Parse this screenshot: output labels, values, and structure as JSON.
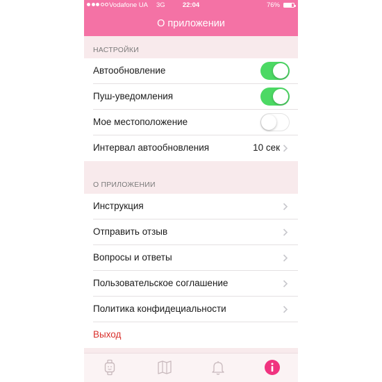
{
  "status_bar": {
    "signal": [
      true,
      true,
      true,
      false,
      false
    ],
    "carrier": "Vodafone UA",
    "network": "3G",
    "time": "22:04",
    "battery_percent": "76%",
    "battery_level": 0.76
  },
  "nav": {
    "title": "О приложении"
  },
  "settings_section": {
    "header": "НАСТРОЙКИ",
    "auto_update": {
      "label": "Автообновление",
      "enabled": true
    },
    "push_notifications": {
      "label": "Пуш-уведомления",
      "enabled": true
    },
    "location": {
      "label": "Мое местоположение",
      "enabled": false
    },
    "update_interval": {
      "label": "Интервал автообновления",
      "value": "10 сек"
    }
  },
  "about_section": {
    "header": "О ПРИЛОЖЕНИИ",
    "items": {
      "instructions": "Инструкция",
      "feedback": "Отправить отзыв",
      "faq": "Вопросы и ответы",
      "user_agreement": "Пользовательское соглашение",
      "privacy_policy": "Политика конфидециальности"
    },
    "logout": "Выход"
  },
  "tab_bar": {
    "tabs": [
      {
        "icon": "watch-icon",
        "active": false
      },
      {
        "icon": "map-icon",
        "active": false
      },
      {
        "icon": "bell-icon",
        "active": false
      },
      {
        "icon": "info-icon",
        "active": true
      }
    ]
  },
  "colors": {
    "accent": "#f472a5",
    "toggle_on": "#4cd964",
    "logout": "#d9302c",
    "tab_inactive": "#c8b9bd",
    "tab_active": "#f0337f"
  }
}
